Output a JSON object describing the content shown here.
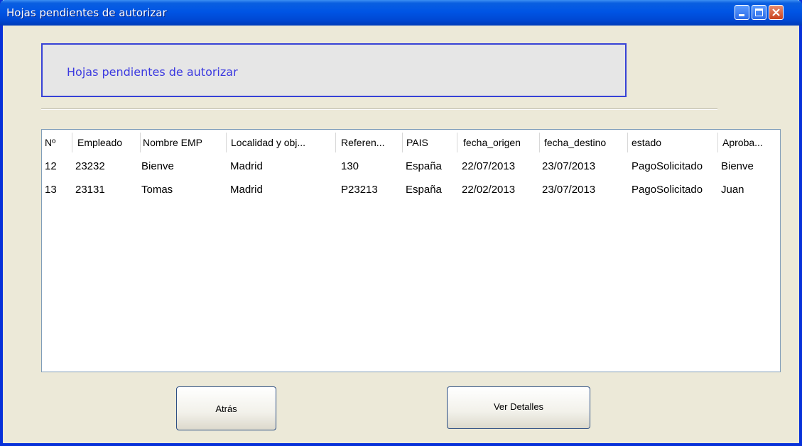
{
  "window": {
    "title": "Hojas pendientes de autorizar"
  },
  "header": {
    "label": "Hojas pendientes de autorizar"
  },
  "table": {
    "columns": [
      "Nº",
      "Empleado",
      "Nombre EMP",
      "Localidad y obj...",
      "Referen...",
      "PAIS",
      "fecha_origen",
      "fecha_destino",
      "estado",
      "Aproba..."
    ],
    "rows": [
      [
        "12",
        "23232",
        "Bienve",
        "Madrid",
        "130",
        "España",
        "22/07/2013",
        "23/07/2013",
        "PagoSolicitado",
        "Bienve"
      ],
      [
        "13",
        "23131",
        "Tomas",
        "Madrid",
        "P23213",
        "España",
        "22/02/2013",
        "23/07/2013",
        "PagoSolicitado",
        "Juan"
      ]
    ]
  },
  "buttons": {
    "back": "Atrás",
    "details": "Ver Detalles"
  },
  "colors": {
    "titlebar": "#0055e5",
    "header_border": "#3742d6",
    "header_text": "#3b39e0",
    "close_button": "#c9431f"
  }
}
